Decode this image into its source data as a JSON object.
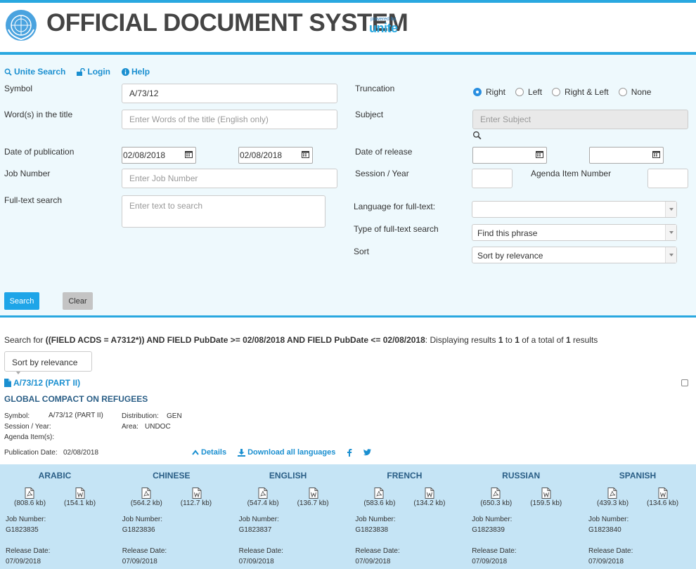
{
  "header": {
    "title": "OFFICIAL DOCUMENT SYSTEM",
    "powered_by": "powered by",
    "brand": "unite",
    "accent_color": "#29a8e0"
  },
  "toplinks": {
    "search": "Unite Search",
    "login": "Login",
    "help": "Help"
  },
  "form": {
    "symbol_label": "Symbol",
    "symbol_value": "A/73/12",
    "title_label": "Word(s) in the title",
    "title_placeholder": "Enter Words of the title (English only)",
    "pubdate_label": "Date of publication",
    "pubdate_from": "02/08/2018",
    "pubdate_to": "02/08/2018",
    "jobnum_label": "Job Number",
    "jobnum_placeholder": "Enter Job Number",
    "fulltext_label": "Full-text search",
    "fulltext_placeholder": "Enter text to search",
    "truncation_label": "Truncation",
    "truncation_options": [
      "Right",
      "Left",
      "Right & Left",
      "None"
    ],
    "truncation_selected": "Right",
    "subject_label": "Subject",
    "subject_placeholder": "Enter Subject",
    "release_label": "Date of release",
    "session_label": "Session / Year",
    "agenda_label": "Agenda Item Number",
    "lang_fulltext_label": "Language for full-text:",
    "lang_fulltext_value": "",
    "type_fulltext_label": "Type of full-text search",
    "type_fulltext_value": "Find this phrase",
    "sort_label": "Sort",
    "sort_value": "Sort by relevance",
    "search_button": "Search",
    "clear_button": "Clear"
  },
  "results": {
    "summary_prefix": "Search for ",
    "summary_query": "((FIELD ACDS = A7312*)) AND FIELD PubDate >= 02/08/2018 AND FIELD PubDate <= 02/08/2018",
    "summary_mid": ": Displaying results ",
    "from": "1",
    "to_word": " to ",
    "to": "1",
    "of_word": " of a total of ",
    "total": "1",
    "results_word": " results",
    "sort_button": "Sort by relevance",
    "doc_symbol_link": "A/73/12 (PART II)",
    "doc_title": "GLOBAL COMPACT ON REFUGEES",
    "symbol_label": "Symbol:",
    "symbol_value": "A/73/12 (PART II)",
    "session_label": "Session / Year:",
    "agenda_label": "Agenda Item(s):",
    "distribution_label": "Distribution:",
    "distribution_value": "GEN",
    "area_label": "Area:",
    "area_value": "UNDOC",
    "pubdate_label": "Publication Date:",
    "pubdate_value": "02/08/2018",
    "details_link": "Details",
    "download_link": "Download all languages"
  },
  "languages": [
    {
      "name": "ARABIC",
      "pdf_size": "(808.6 kb)",
      "doc_size": "(154.1 kb)",
      "job_label": "Job Number:",
      "job": "G1823835",
      "release_label": "Release Date:",
      "release": "07/09/2018"
    },
    {
      "name": "CHINESE",
      "pdf_size": "(564.2 kb)",
      "doc_size": "(112.7 kb)",
      "job_label": "Job Number:",
      "job": "G1823836",
      "release_label": "Release Date:",
      "release": "07/09/2018"
    },
    {
      "name": "ENGLISH",
      "pdf_size": "(547.4 kb)",
      "doc_size": "(136.7 kb)",
      "job_label": "Job Number:",
      "job": "G1823837",
      "release_label": "Release Date:",
      "release": "07/09/2018"
    },
    {
      "name": "FRENCH",
      "pdf_size": "(583.6 kb)",
      "doc_size": "(134.2 kb)",
      "job_label": "Job Number:",
      "job": "G1823838",
      "release_label": "Release Date:",
      "release": "07/09/2018"
    },
    {
      "name": "RUSSIAN",
      "pdf_size": "(650.3 kb)",
      "doc_size": "(159.5 kb)",
      "job_label": "Job Number:",
      "job": "G1823839",
      "release_label": "Release Date:",
      "release": "07/09/2018"
    },
    {
      "name": "SPANISH",
      "pdf_size": "(439.3 kb)",
      "doc_size": "(134.6 kb)",
      "job_label": "Job Number:",
      "job": "G1823840",
      "release_label": "Release Date:",
      "release": "07/09/2018"
    }
  ]
}
